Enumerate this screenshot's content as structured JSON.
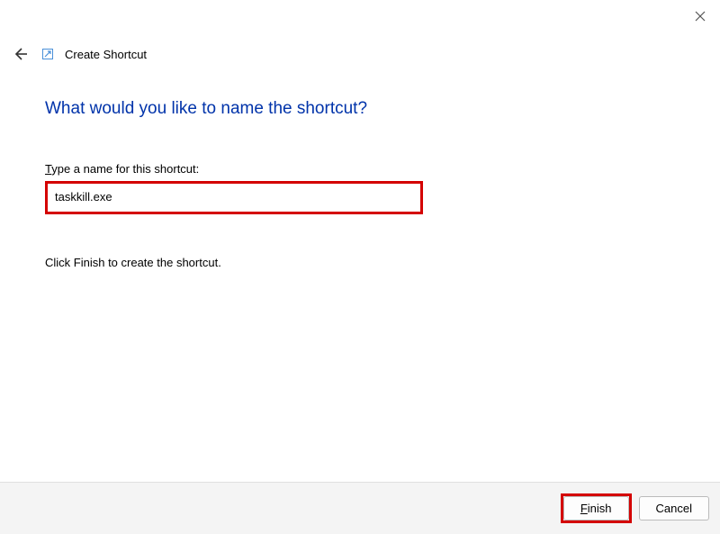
{
  "window": {
    "wizard_title": "Create Shortcut"
  },
  "content": {
    "heading": "What would you like to name the shortcut?",
    "field_label_prefix": "T",
    "field_label_rest": "ype a name for this shortcut:",
    "input_value": "taskkill.exe",
    "hint": "Click Finish to create the shortcut."
  },
  "footer": {
    "finish_prefix": "F",
    "finish_rest": "inish",
    "cancel_label": "Cancel"
  }
}
